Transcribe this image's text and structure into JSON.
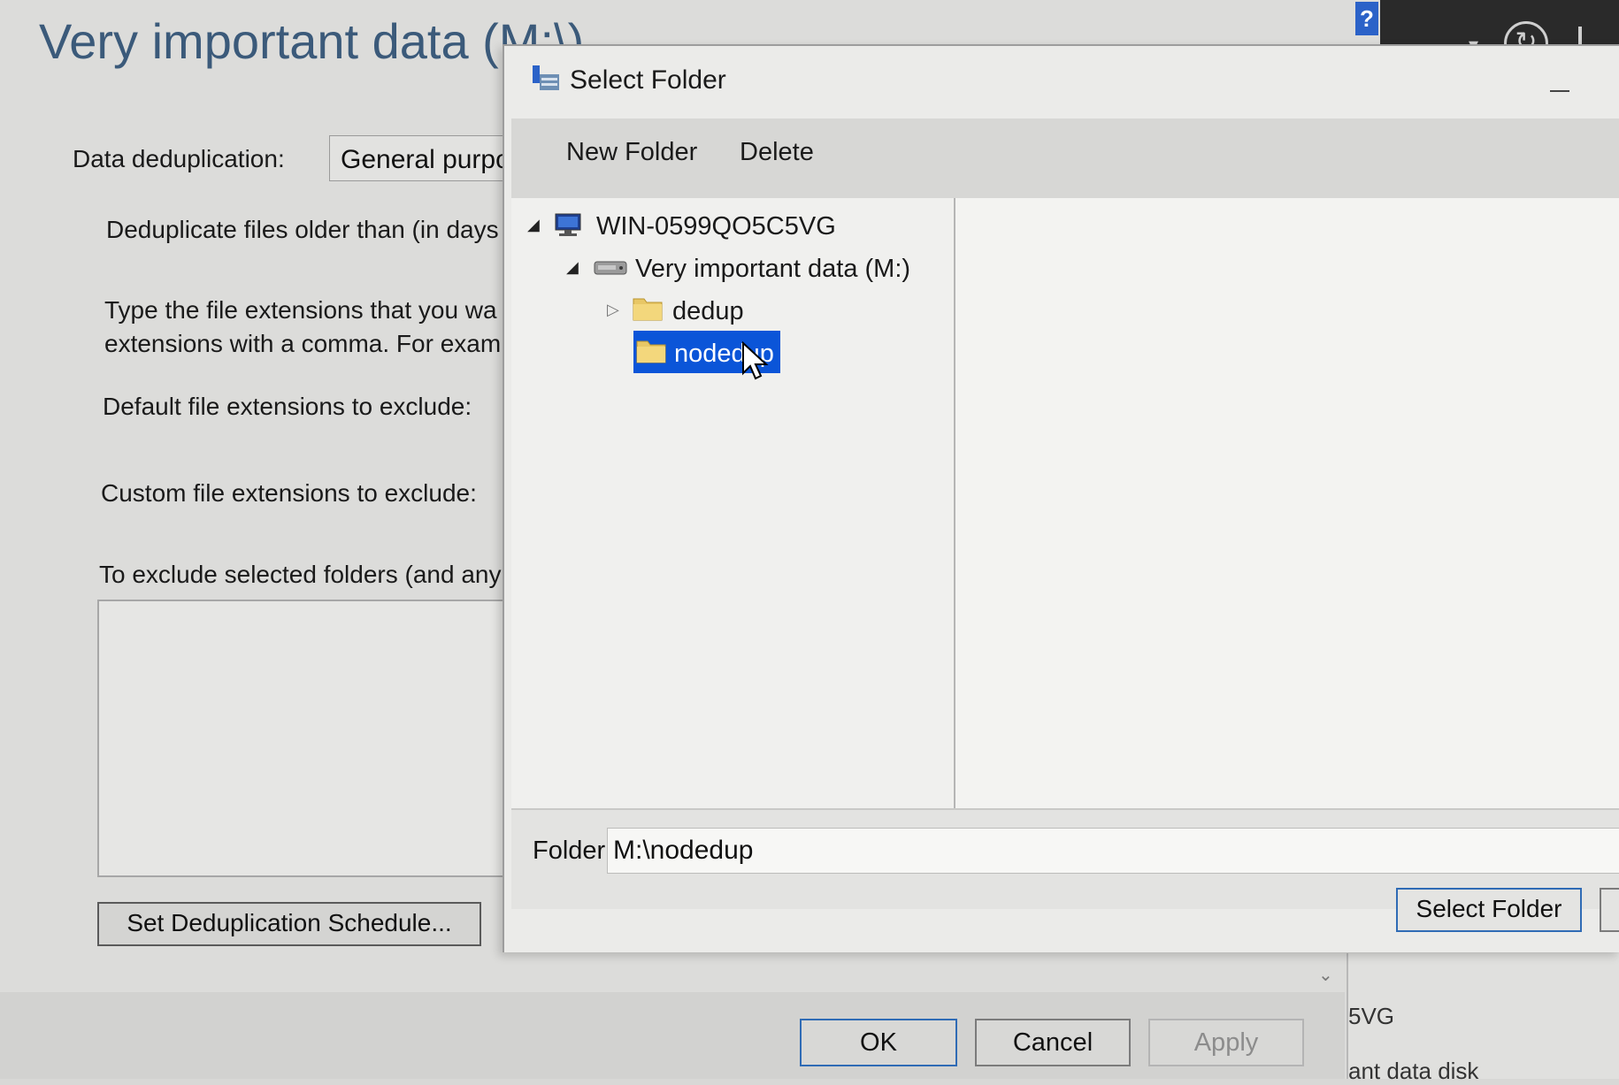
{
  "props": {
    "title": "Very important data (M:\\)",
    "dedup_label": "Data deduplication:",
    "dedup_value": "General purpos",
    "older_than_label": "Deduplicate files older than (in days",
    "ext_instructions_1": "Type the file extensions that you wa",
    "ext_instructions_2": "extensions with a comma. For exam",
    "default_ext_label": "Default file extensions to exclude:",
    "custom_ext_label": "Custom file extensions to exclude:",
    "exclude_folders_label": "To exclude selected folders (and any",
    "schedule_button": "Set Deduplication Schedule...",
    "ok_button": "OK",
    "cancel_button": "Cancel",
    "apply_button": "Apply",
    "side_text_1": "5VG",
    "side_text_2": "ant data disk"
  },
  "dialog": {
    "title": "Select Folder",
    "toolbar": {
      "new_folder": "New Folder",
      "delete": "Delete"
    },
    "tree": [
      {
        "label": "WIN-0599QO5C5VG",
        "state": "expanded",
        "icon": "computer-icon"
      },
      {
        "label": "Very important data (M:)",
        "state": "expanded",
        "icon": "drive-icon"
      },
      {
        "label": "dedup",
        "state": "collapsed",
        "icon": "folder-icon"
      },
      {
        "label": "nodedup",
        "state": "selected",
        "icon": "folder-icon"
      }
    ],
    "folder_label": "Folder:",
    "folder_value": "M:\\nodedup",
    "select_button": "Select Folder"
  },
  "colors": {
    "selection": "#0b55d8",
    "accent_border": "#2f6bb5",
    "title_text": "#3b5a7a"
  }
}
